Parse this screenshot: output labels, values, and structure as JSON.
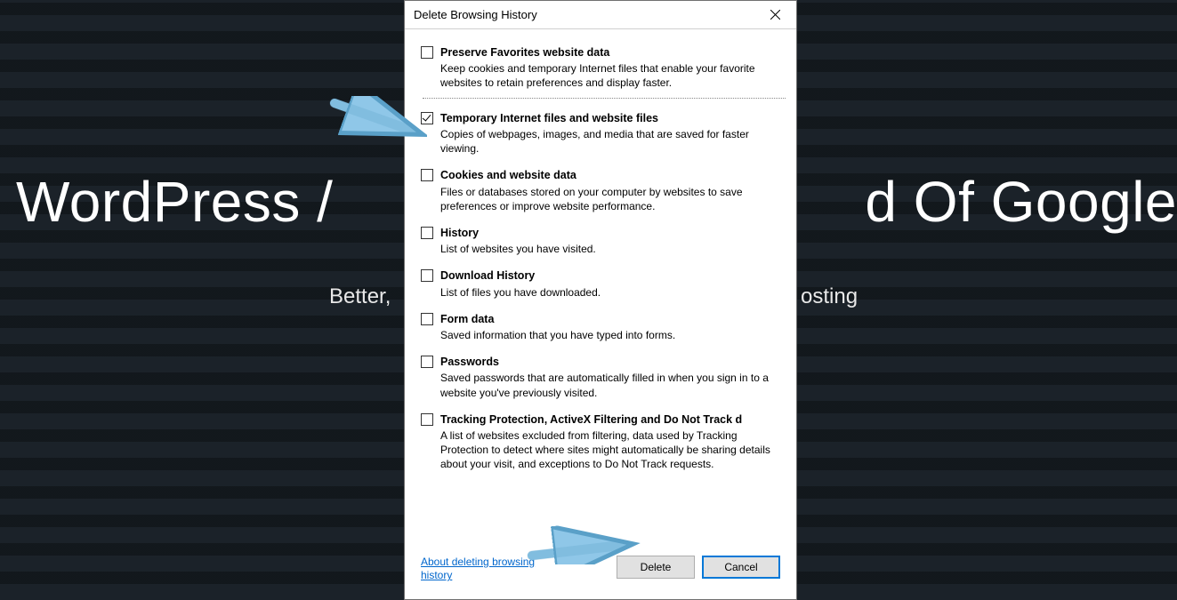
{
  "background": {
    "title_left": "WordPress /",
    "title_right": "d Of Google",
    "sub_left": "Better, ",
    "sub_right": "osting"
  },
  "dialog": {
    "title": "Delete Browsing History",
    "options": [
      {
        "checked": false,
        "label": "Preserve Favorites website data",
        "desc": "Keep cookies and temporary Internet files that enable your favorite websites to retain preferences and display faster."
      },
      {
        "checked": true,
        "label": "Temporary Internet files and website files",
        "desc": "Copies of webpages, images, and media that are saved for faster viewing."
      },
      {
        "checked": false,
        "label": "Cookies and website data",
        "desc": "Files or databases stored on your computer by websites to save preferences or improve website performance."
      },
      {
        "checked": false,
        "label": "History",
        "desc": "List of websites you have visited."
      },
      {
        "checked": false,
        "label": "Download History",
        "desc": "List of files you have downloaded."
      },
      {
        "checked": false,
        "label": "Form data",
        "desc": "Saved information that you have typed into forms."
      },
      {
        "checked": false,
        "label": "Passwords",
        "desc": "Saved passwords that are automatically filled in when you sign in to a website you've previously visited."
      },
      {
        "checked": false,
        "label": "Tracking Protection, ActiveX Filtering and Do Not Track d",
        "desc": "A list of websites excluded from filtering, data used by Tracking Protection to detect where sites might automatically be sharing details about your visit, and exceptions to Do Not Track requests."
      }
    ],
    "link": "About deleting browsing history",
    "delete_label": "Delete",
    "cancel_label": "Cancel"
  }
}
